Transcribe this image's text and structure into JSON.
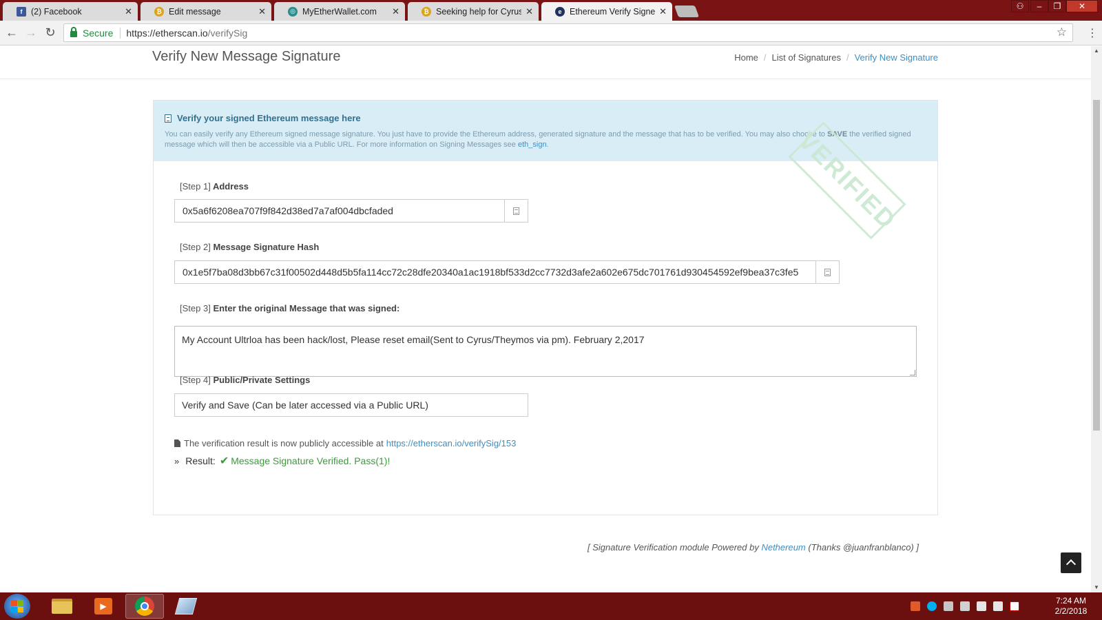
{
  "browser": {
    "tabs": [
      {
        "label": "(2) Facebook",
        "icon": "facebook-icon"
      },
      {
        "label": "Edit message",
        "icon": "bitcoin-icon"
      },
      {
        "label": "MyEtherWallet.com",
        "icon": "myetherwallet-icon"
      },
      {
        "label": "Seeking help for Cyrus/Th",
        "icon": "bitcoin-icon"
      },
      {
        "label": "Ethereum Verify Signed M",
        "icon": "etherscan-icon"
      }
    ],
    "secure_label": "Secure",
    "url_host": "https://etherscan.io",
    "url_path": "/verifySig"
  },
  "page": {
    "title": "Verify New Message Signature",
    "breadcrumb": [
      "Home",
      "List of Signatures",
      "Verify New Signature"
    ],
    "alert": {
      "title": "Verify your signed Ethereum message here",
      "text_1": "You can easily verify any Ethereum signed message signature. You just have to provide the Ethereum address, generated signature and the message that has to be verified. You may also choose to ",
      "text_bold": "SAVE",
      "text_2": " the verified signed message which will then be accessible via a Public URL. For more information on Signing Messages see ",
      "link": "eth_sign",
      "text_end": "."
    },
    "stamp": "VERIFIED",
    "steps": [
      {
        "num": "[Step 1]",
        "label": "Address",
        "value": "0x5a6f6208ea707f9f842d38ed7a7af004dbcfaded"
      },
      {
        "num": "[Step 2]",
        "label": "Message Signature Hash",
        "value": "0x1e5f7ba08d3bb67c31f00502d448d5b5fa114cc72c28dfe20340a1ac1918bf533d2cc7732d3afe2a602e675dc701761d930454592ef9bea37c3fe5"
      },
      {
        "num": "[Step 3]",
        "label": "Enter the original Message that was signed:",
        "value": "My Account Ultrloa has been hack/lost, Please reset email(Sent to Cyrus/Theymos via pm). February 2,2017"
      },
      {
        "num": "[Step 4]",
        "label": "Public/Private Settings",
        "value": "Verify and Save (Can be later accessed via a Public URL)"
      }
    ],
    "public_note": "The verification result is now publicly accessible at",
    "public_url": "https://etherscan.io/verifySig/153",
    "result_label": "Result:",
    "result_message": "Message Signature Verified. Pass(1)!",
    "footer_1": "[ Signature Verification module Powered by ",
    "footer_link": "Nethereum",
    "footer_2": " (Thanks @juanfranblanco) ]"
  },
  "taskbar": {
    "time": "7:24 AM",
    "date": "2/2/2018"
  },
  "colors": {
    "tabstrip": "#7a1414",
    "taskbar": "#6b0f0f",
    "alert_bg": "#d9edf7",
    "link": "#3b8fc4",
    "success": "#3c9a3c"
  }
}
